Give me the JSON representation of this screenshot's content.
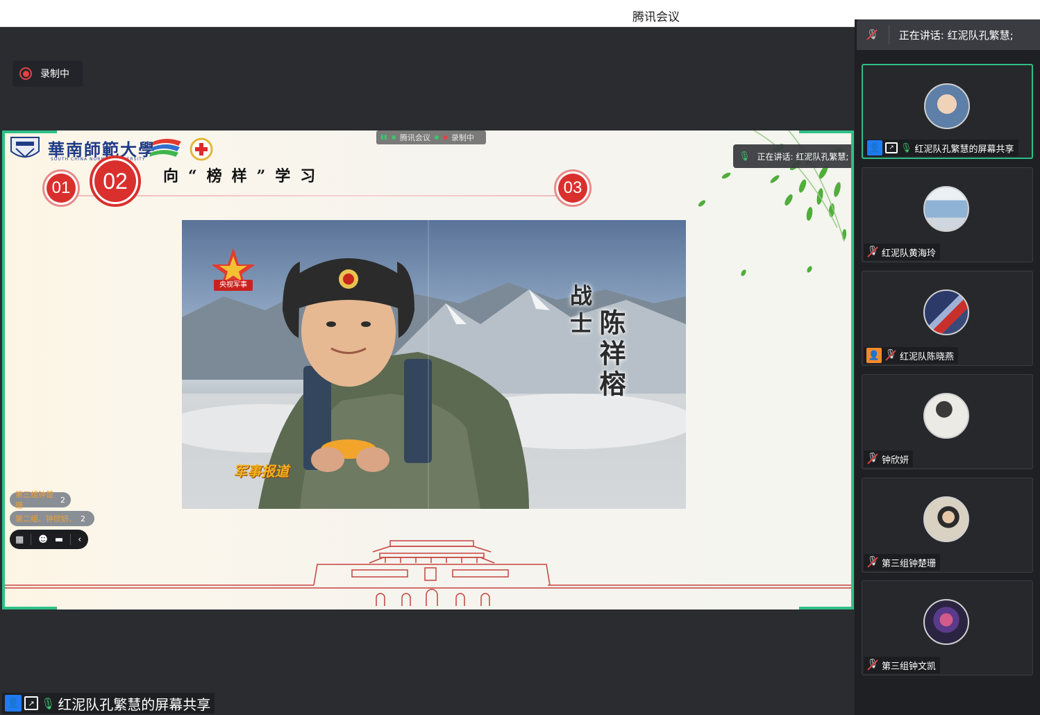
{
  "window": {
    "title": "腾讯会议"
  },
  "recording": {
    "label": "录制中"
  },
  "speaking": {
    "label": "正在讲话: 红泥队孔繁慧;"
  },
  "slide": {
    "university_name": "華南師範大學",
    "university_en": "SOUTH CHINA NORMAL UNIVERSITY",
    "steps": [
      "01",
      "02",
      "03"
    ],
    "heading": "向“榜样”学习",
    "video_caption_a": "战士",
    "video_caption_b": "陈祥榕",
    "video_logo_label": "央视军事",
    "video_show_logo": "军事报道",
    "floating_bar": {
      "app": "腾讯会议",
      "rec": "录制中"
    },
    "inner_speaking": "正在讲话: 红泥队孔繁慧;"
  },
  "chat_pills": [
    {
      "orange": "第三组钟楚珊",
      "count": "2"
    },
    {
      "orange": "第二组、钟欣妍、",
      "count": "2"
    }
  ],
  "toolbar_icons": [
    "layout-icon",
    "emoji-icon",
    "chat-icon",
    "collapse-icon"
  ],
  "share_label": "红泥队孔繁慧的屏幕共享",
  "participants": [
    {
      "name": "红泥队孔繁慧的屏幕共享",
      "active": true,
      "badge": "person-blue",
      "screen": true,
      "mic": "on",
      "avatar_color": "#5d7fa8"
    },
    {
      "name": "红泥队黄海玲",
      "active": false,
      "badge": "",
      "screen": false,
      "mic": "muted",
      "avatar_color": "#cfd6de"
    },
    {
      "name": "红泥队陈晓燕",
      "active": false,
      "badge": "person-orange",
      "screen": false,
      "mic": "muted",
      "avatar_color": "#3a4a78"
    },
    {
      "name": "钟欣妍",
      "active": false,
      "badge": "",
      "screen": false,
      "mic": "muted",
      "avatar_color": "#eceae4"
    },
    {
      "name": "第三组钟楚珊",
      "active": false,
      "badge": "",
      "screen": false,
      "mic": "muted",
      "avatar_color": "#7a8a9a"
    },
    {
      "name": "第三组钟文凯",
      "active": false,
      "badge": "",
      "screen": false,
      "mic": "muted",
      "avatar_color": "#2a2440"
    }
  ],
  "colors": {
    "accent_green": "#2fbf87",
    "record_red": "#e04343",
    "step_red": "#d9302d",
    "participant_blue": "#1f7bf4",
    "participant_orange": "#f48a2b"
  }
}
